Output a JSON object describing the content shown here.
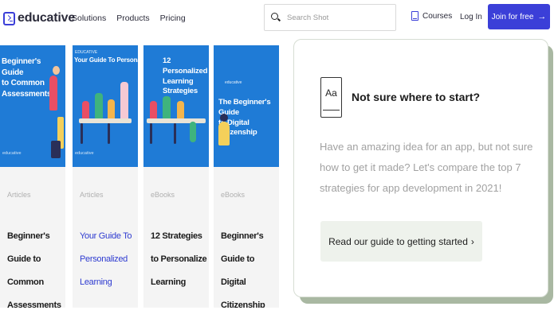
{
  "header": {
    "logo_text": "educative",
    "nav": [
      "Solutions",
      "Products",
      "Pricing"
    ],
    "search_placeholder": "Search Shot",
    "courses_label": "Courses",
    "login_label": "Log In",
    "join_label": "Join for free",
    "join_arrow": "→",
    "brand_color": "#3b3fd8"
  },
  "cards": [
    {
      "image_title": "Beginner's Guide\nto Common\nAssessments",
      "image_brand": "educative",
      "image_sub": "",
      "type": "Articles",
      "title": "Beginner's Guide to Common Assessments",
      "title_link": false
    },
    {
      "image_title": "Your Guide To Personalized Learning",
      "image_brand": "educative",
      "image_sub": "EDUCATIVE",
      "type": "Articles",
      "title": "Your Guide To Personalized Learning",
      "title_link": true
    },
    {
      "image_title": "12 Personalized\nLearning Strategies",
      "image_brand": "",
      "image_sub": "",
      "type": "eBooks",
      "title": "12 Strategies to Personalize Learning",
      "title_link": false
    },
    {
      "image_title": "The Beginner's Guide\nto Digital Citizenship",
      "image_brand": "",
      "image_sub": "educative",
      "type": "eBooks",
      "title": "Beginner's Guide to Digital Citizenship",
      "title_link": false
    }
  ],
  "panel": {
    "icon_text": "Aa",
    "title": "Not sure where to start?",
    "body": "Have an amazing idea for an app, but not sure how to get it made? Let's compare the top 7 strategies for app development in 2021!",
    "cta_label": "Read our guide to getting started",
    "cta_chevron": "›"
  }
}
